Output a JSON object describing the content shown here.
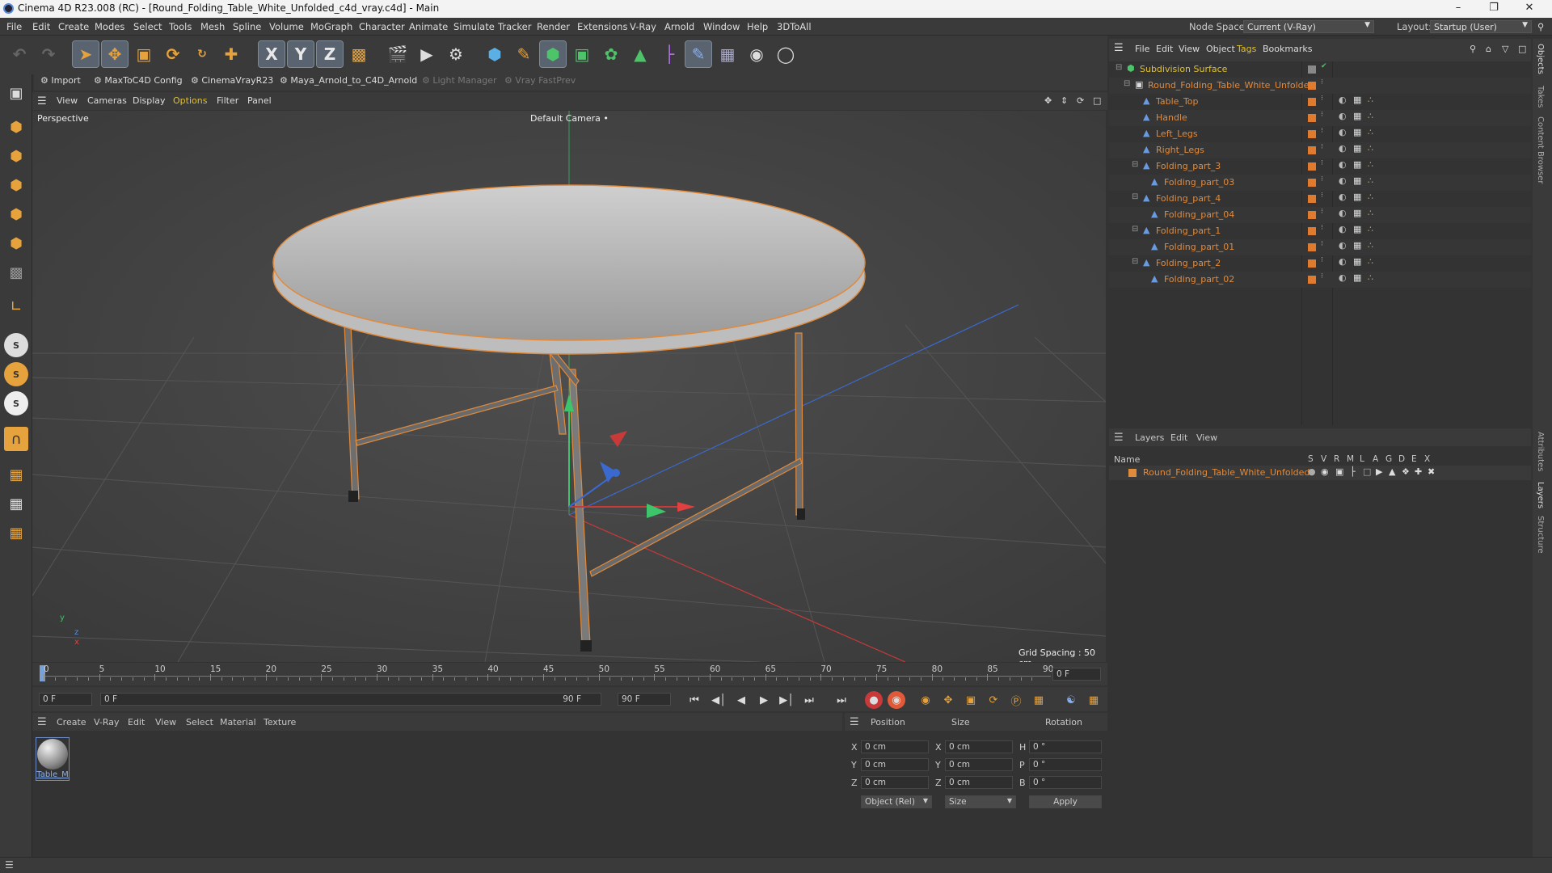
{
  "window": {
    "title": "Cinema 4D R23.008 (RC) - [Round_Folding_Table_White_Unfolded_c4d_vray.c4d] - Main"
  },
  "menu": {
    "items": [
      "File",
      "Edit",
      "Create",
      "Modes",
      "Select",
      "Tools",
      "Mesh",
      "Spline",
      "Volume",
      "MoGraph",
      "Character",
      "Animate",
      "Simulate",
      "Tracker",
      "Render",
      "Extensions",
      "V-Ray",
      "Arnold",
      "Window",
      "Help",
      "3DToAll"
    ],
    "node_space_label": "Node Space:",
    "node_space_value": "Current (V-Ray)",
    "layout_label": "Layout:",
    "layout_value": "Startup (User)"
  },
  "toolbar": {
    "x": "X",
    "y": "Y",
    "z": "Z"
  },
  "plugins": {
    "import": "Import",
    "maxtoc4d": "MaxToC4D Config",
    "cinemavray": "CinemaVrayR23",
    "maya_arnold": "Maya_Arnold_to_C4D_Arnold",
    "light_manager": "Light Manager",
    "vray_fastprev": "Vray FastPrev"
  },
  "viewport_menu": {
    "items": [
      "View",
      "Cameras",
      "Display",
      "Options",
      "Filter",
      "Panel"
    ]
  },
  "viewport": {
    "label": "Perspective",
    "camera": "Default Camera",
    "grid_spacing": "Grid Spacing : 50 cm",
    "axis_y": "y",
    "axis_z": "z",
    "axis_x": "x"
  },
  "timeline": {
    "ticks": [
      "0",
      "5",
      "10",
      "15",
      "20",
      "25",
      "30",
      "35",
      "40",
      "45",
      "50",
      "55",
      "60",
      "65",
      "70",
      "75",
      "80",
      "85",
      "90"
    ],
    "current_frame": "0 F"
  },
  "anim": {
    "start": "0 F",
    "range_start": "0 F",
    "range_end": "90 F",
    "end": "90 F"
  },
  "material_manager": {
    "menu": [
      "Create",
      "V-Ray",
      "Edit",
      "View",
      "Select",
      "Material",
      "Texture"
    ],
    "material_name": "Table_M"
  },
  "coordinates": {
    "position_label": "Position",
    "size_label": "Size",
    "rotation_label": "Rotation",
    "px": "0 cm",
    "py": "0 cm",
    "pz": "0 cm",
    "sx": "0 cm",
    "sy": "0 cm",
    "sz": "0 cm",
    "rh": "0 °",
    "rp": "0 °",
    "rb": "0 °",
    "lx": "X",
    "ly": "Y",
    "lz": "Z",
    "lh": "H",
    "lp": "P",
    "lb": "B",
    "mode": "Object (Rel)",
    "size_mode": "Size",
    "apply": "Apply"
  },
  "object_manager": {
    "menu": [
      "File",
      "Edit",
      "View",
      "Object",
      "Tags",
      "Bookmarks"
    ],
    "objects": [
      "Subdivision Surface",
      "Round_Folding_Table_White_Unfolded",
      "Table_Top",
      "Handle",
      "Left_Legs",
      "Right_Legs",
      "Folding_part_3",
      "Folding_part_03",
      "Folding_part_4",
      "Folding_part_04",
      "Folding_part_1",
      "Folding_part_01",
      "Folding_part_2",
      "Folding_part_02"
    ]
  },
  "layer_manager": {
    "menu": [
      "Layers",
      "Edit",
      "View"
    ],
    "col_name": "Name",
    "cols": [
      "S",
      "V",
      "R",
      "M",
      "L",
      "A",
      "G",
      "D",
      "E",
      "X"
    ],
    "layer": "Round_Folding_Table_White_Unfolded"
  },
  "right_tabs": [
    "Objects",
    "Takes",
    "Content Browser",
    "Attributes",
    "Layers",
    "Structure"
  ],
  "colors": {
    "accent_orange": "#e08a3c",
    "bg": "#333333",
    "viewport": "#474747"
  }
}
